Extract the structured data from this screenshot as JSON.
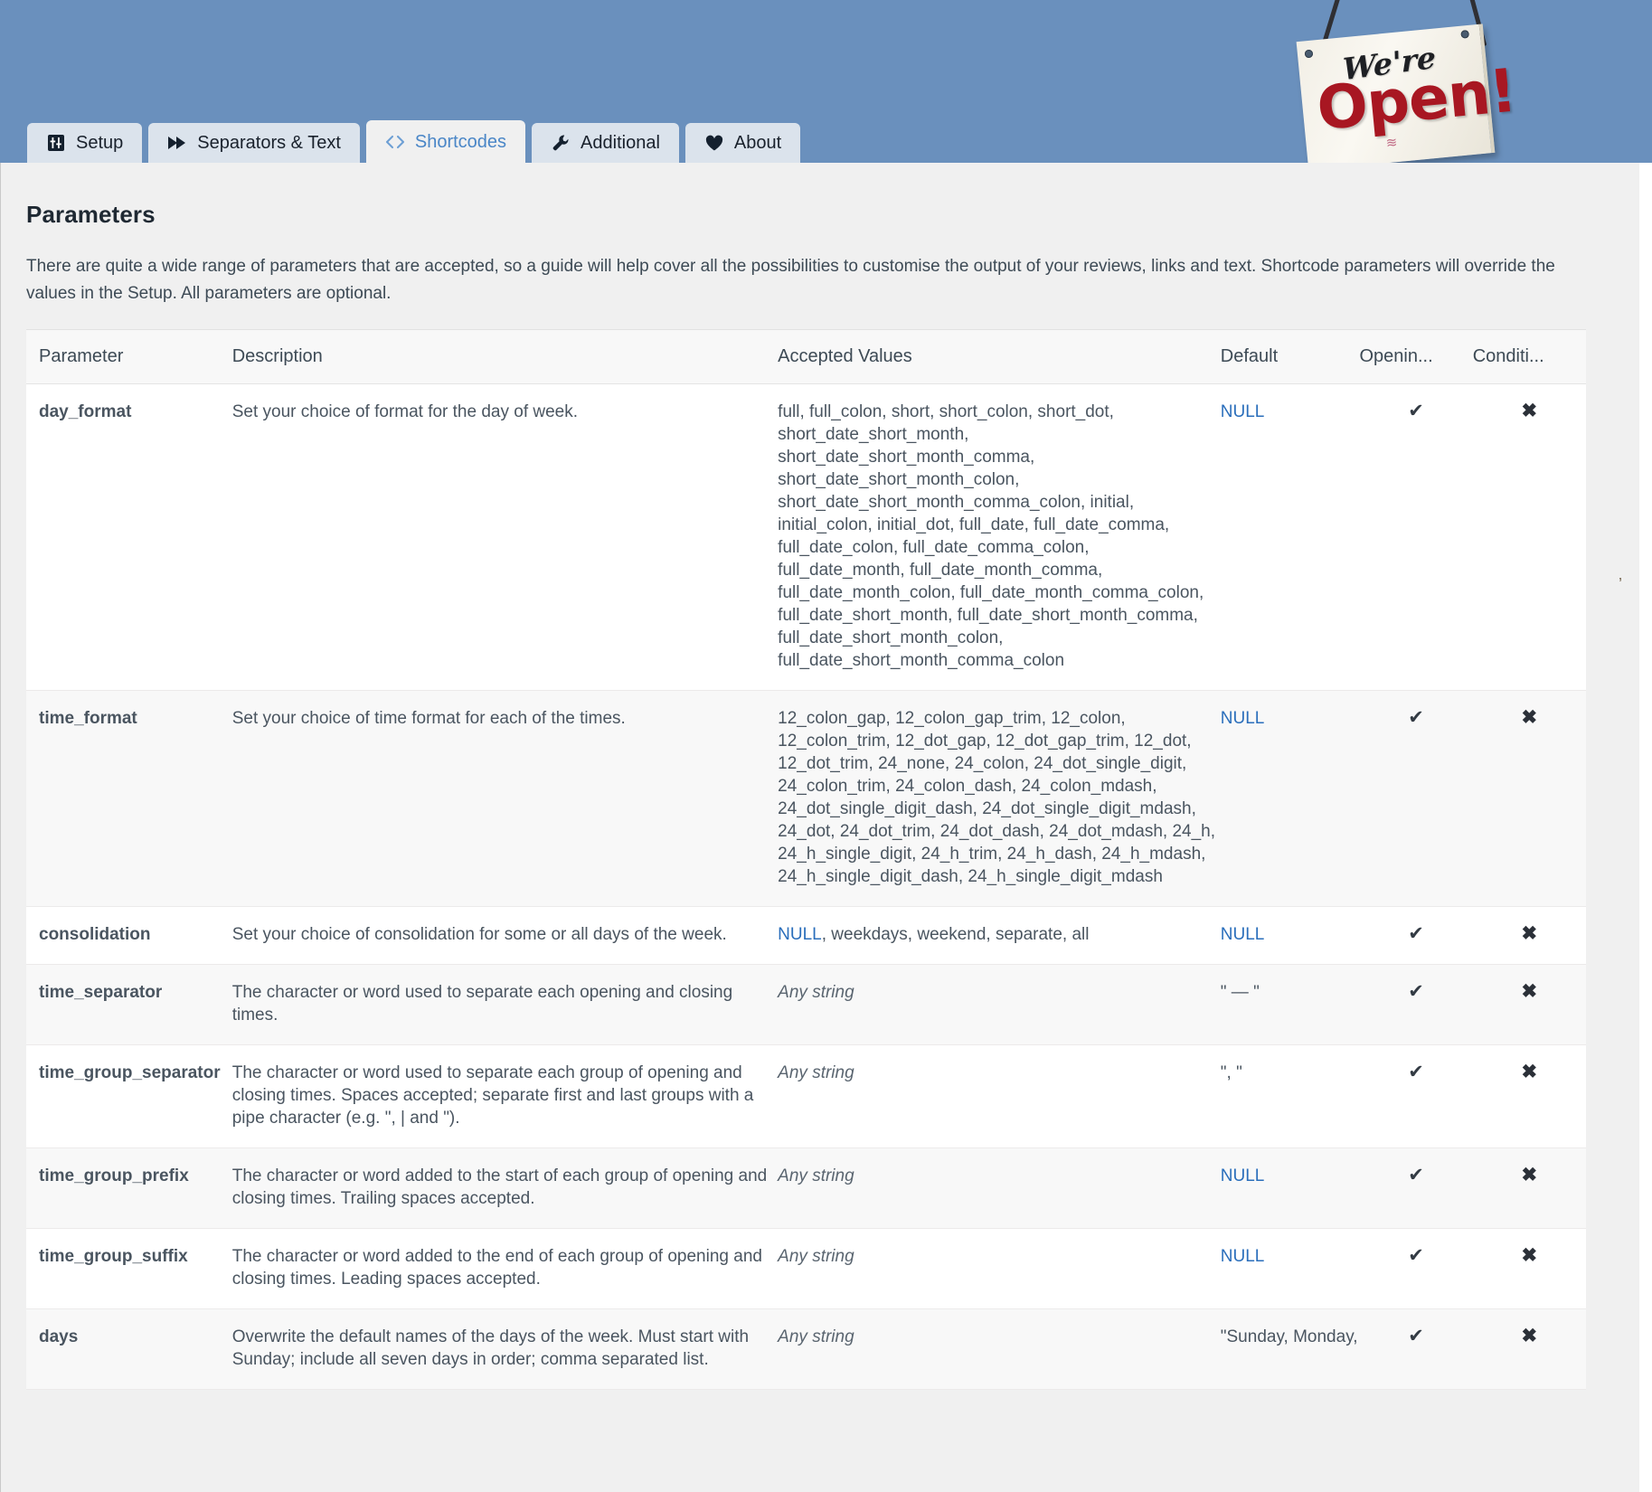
{
  "banner": {
    "sign": {
      "line1": "We're",
      "line2": "Open!",
      "flourish": "≋"
    }
  },
  "tabs": [
    {
      "id": "setup",
      "label": "Setup",
      "icon": "sliders-icon",
      "active": false
    },
    {
      "id": "separators",
      "label": "Separators & Text",
      "icon": "forward-icon",
      "active": false
    },
    {
      "id": "shortcodes",
      "label": "Shortcodes",
      "icon": "code-icon",
      "active": true
    },
    {
      "id": "additional",
      "label": "Additional",
      "icon": "wrench-icon",
      "active": false
    },
    {
      "id": "about",
      "label": "About",
      "icon": "heart-icon",
      "active": false
    }
  ],
  "main": {
    "title": "Parameters",
    "intro": "There are quite a wide range of parameters that are accepted, so a guide will help cover all the possibilities to customise the output of your reviews, links and text. Shortcode parameters will override the values in the Setup. All parameters are optional.",
    "gutter_glyph": "’"
  },
  "table": {
    "columns": [
      {
        "key": "parameter",
        "label": "Parameter"
      },
      {
        "key": "description",
        "label": "Description"
      },
      {
        "key": "accepted_values",
        "label": "Accepted Values"
      },
      {
        "key": "default",
        "label": "Default"
      },
      {
        "key": "opening",
        "label": "Openin..."
      },
      {
        "key": "conditional",
        "label": "Conditi..."
      }
    ],
    "check_glyph": "✔",
    "cross_glyph": "✖",
    "rows": [
      {
        "parameter": "day_format",
        "description": "Set your choice of format for the day of week.",
        "accepted_values": "full, full_colon, short, short_colon, short_dot, short_date_short_month, short_date_short_month_comma, short_date_short_month_colon, short_date_short_month_comma_colon, initial, initial_colon, initial_dot, full_date, full_date_comma, full_date_colon, full_date_comma_colon, full_date_month, full_date_month_comma, full_date_month_colon, full_date_month_comma_colon, full_date_short_month, full_date_short_month_comma, full_date_short_month_colon, full_date_short_month_comma_colon",
        "accepted_values_is_null_prefix": false,
        "default": "NULL",
        "default_is_null": true,
        "opening": true,
        "conditional": false
      },
      {
        "parameter": "time_format",
        "description": "Set your choice of time format for each of the times.",
        "accepted_values": "12_colon_gap, 12_colon_gap_trim, 12_colon, 12_colon_trim, 12_dot_gap, 12_dot_gap_trim, 12_dot, 12_dot_trim, 24_none, 24_colon, 24_dot_single_digit, 24_colon_trim, 24_colon_dash, 24_colon_mdash, 24_dot_single_digit_dash, 24_dot_single_digit_mdash, 24_dot, 24_dot_trim, 24_dot_dash, 24_dot_mdash, 24_h, 24_h_single_digit, 24_h_trim, 24_h_dash, 24_h_mdash, 24_h_single_digit_dash, 24_h_single_digit_mdash",
        "accepted_values_is_null_prefix": false,
        "default": "NULL",
        "default_is_null": true,
        "opening": true,
        "conditional": false
      },
      {
        "parameter": "consolidation",
        "description": "Set your choice of consolidation for some or all days of the week.",
        "accepted_values": ", weekdays, weekend, separate, all",
        "accepted_values_is_null_prefix": true,
        "accepted_values_null_label": "NULL",
        "default": "NULL",
        "default_is_null": true,
        "opening": true,
        "conditional": false
      },
      {
        "parameter": "time_separator",
        "description": "The character or word used to separate each opening and closing times.",
        "accepted_values": "Any string",
        "accepted_values_italic": true,
        "default": "\" — \"",
        "default_is_null": false,
        "opening": true,
        "conditional": false
      },
      {
        "parameter": "time_group_separator",
        "description": "The character or word used to separate each group of opening and closing times. Spaces accepted; separate first and last groups with a pipe character (e.g. \", | and \").",
        "accepted_values": "Any string",
        "accepted_values_italic": true,
        "default": "\", \"",
        "default_is_null": false,
        "opening": true,
        "conditional": false
      },
      {
        "parameter": "time_group_prefix",
        "description": "The character or word added to the start of each group of opening and closing times. Trailing spaces accepted.",
        "accepted_values": "Any string",
        "accepted_values_italic": true,
        "default": "NULL",
        "default_is_null": true,
        "opening": true,
        "conditional": false
      },
      {
        "parameter": "time_group_suffix",
        "description": "The character or word added to the end of each group of opening and closing times. Leading spaces accepted.",
        "accepted_values": "Any string",
        "accepted_values_italic": true,
        "default": "NULL",
        "default_is_null": true,
        "opening": true,
        "conditional": false
      },
      {
        "parameter": "days",
        "description": "Overwrite the default names of the days of the week. Must start with Sunday; include all seven days in order; comma separated list.",
        "accepted_values": "Any string",
        "accepted_values_italic": true,
        "default": "\"Sunday, Monday,",
        "default_is_null": false,
        "opening": true,
        "conditional": false
      }
    ]
  }
}
